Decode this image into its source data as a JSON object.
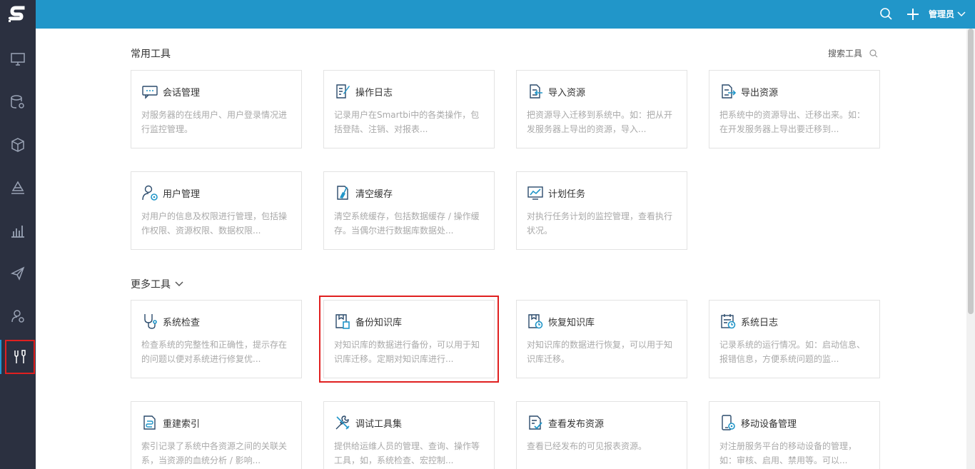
{
  "topbar": {
    "user_label": "管理员"
  },
  "sidebar": {
    "items": [
      {
        "icon": "monitor-icon"
      },
      {
        "icon": "database-gear-icon"
      },
      {
        "icon": "cube-icon"
      },
      {
        "icon": "layers-icon"
      },
      {
        "icon": "bar-chart-icon"
      },
      {
        "icon": "paper-plane-icon"
      },
      {
        "icon": "user-settings-icon"
      },
      {
        "icon": "tools-icon"
      }
    ]
  },
  "common_tools": {
    "title": "常用工具",
    "search_label": "搜索工具",
    "cards": [
      {
        "title": "会话管理",
        "desc": "对服务器的在线用户、用户登录情况进行监控管理。",
        "icon": "chat-icon"
      },
      {
        "title": "操作日志",
        "desc": "记录用户在Smartbi中的各类操作，包括登陆、注销、对报表...",
        "icon": "edit-log-icon"
      },
      {
        "title": "导入资源",
        "desc": "把资源导入迁移到系统中。如：把从开发服务器上导出的资源，导入...",
        "icon": "import-icon"
      },
      {
        "title": "导出资源",
        "desc": "把系统中的资源导出、迁移出来。如：在开发服务器上导出要迁移到...",
        "icon": "export-icon"
      },
      {
        "title": "用户管理",
        "desc": "对用户的信息及权限进行管理，包括操作权限、资源权限、数据权限...",
        "icon": "user-gear-icon"
      },
      {
        "title": "清空缓存",
        "desc": "清空系统缓存，包括数据缓存 / 操作缓存。当偶尔进行数据库数据处...",
        "icon": "broom-icon"
      },
      {
        "title": "计划任务",
        "desc": "对执行任务计划的监控管理，查看执行状况。",
        "icon": "trend-chart-icon"
      }
    ]
  },
  "more_tools": {
    "title": "更多工具",
    "cards": [
      {
        "title": "系统检查",
        "desc": "检查系统的完整性和正确性，提示存在的问题以便对系统进行修复优...",
        "icon": "stethoscope-icon"
      },
      {
        "title": "备份知识库",
        "desc": "对知识库的数据进行备份，可以用于知识库迁移。定期对知识库进行...",
        "icon": "backup-icon"
      },
      {
        "title": "恢复知识库",
        "desc": "对知识库的数据进行恢复，可以用于知识库迁移。",
        "icon": "restore-icon"
      },
      {
        "title": "系统日志",
        "desc": "记录系统的运行情况。如：启动信息、报错信息，方便系统问题的监...",
        "icon": "calendar-clock-icon"
      },
      {
        "title": "重建索引",
        "desc": "索引记录了系统中各资源之间的关联关系，当资源的血统分析 / 影响...",
        "icon": "index-icon"
      },
      {
        "title": "调试工具集",
        "desc": "提供给运维人员的管理、查询、操作等工具，如，系统检查、宏控制...",
        "icon": "wrench-icon"
      },
      {
        "title": "查看发布资源",
        "desc": "查看已经发布的可见报表资源。",
        "icon": "checklist-icon"
      },
      {
        "title": "移动设备管理",
        "desc": "对注册服务平台的移动设备的管理，如：审核、启用、禁用等。可以...",
        "icon": "mobile-gear-icon"
      }
    ]
  }
}
